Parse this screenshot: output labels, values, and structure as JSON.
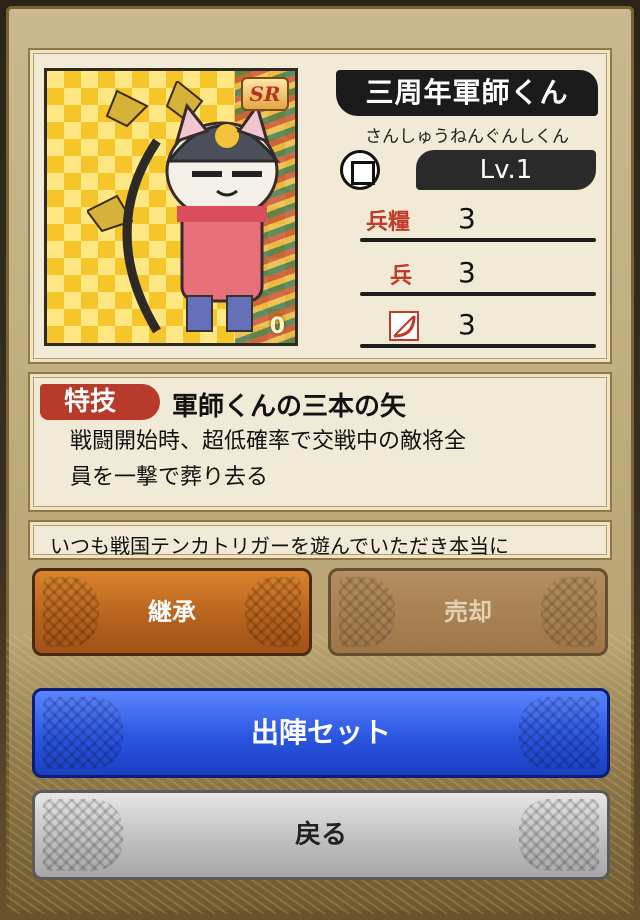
{
  "card": {
    "rarity": "SR",
    "corner_mark": "0",
    "name": "三周年軍師くん",
    "reading": "さんしゅうねんぐんしくん",
    "level": "Lv.1",
    "stats": [
      {
        "label": "兵糧",
        "icon": "rice-sack-icon",
        "value": "3"
      },
      {
        "label": "兵",
        "icon": "soldier-icon",
        "value": "3"
      },
      {
        "label": "",
        "icon": "bow-icon",
        "value": "3"
      }
    ]
  },
  "skill": {
    "tag": "特技",
    "name": "軍師くんの三本の矢",
    "desc_line1": "戦闘開始時、超低確率で交戦中の敵将全",
    "desc_line2": "員を一撃で葬り去る"
  },
  "flavor": "いつも戦国テンカトリガーを遊んでいただき本当に",
  "buttons": {
    "inherit": "継承",
    "sell": "売却",
    "deploy": "出陣セット",
    "back": "戻る"
  }
}
